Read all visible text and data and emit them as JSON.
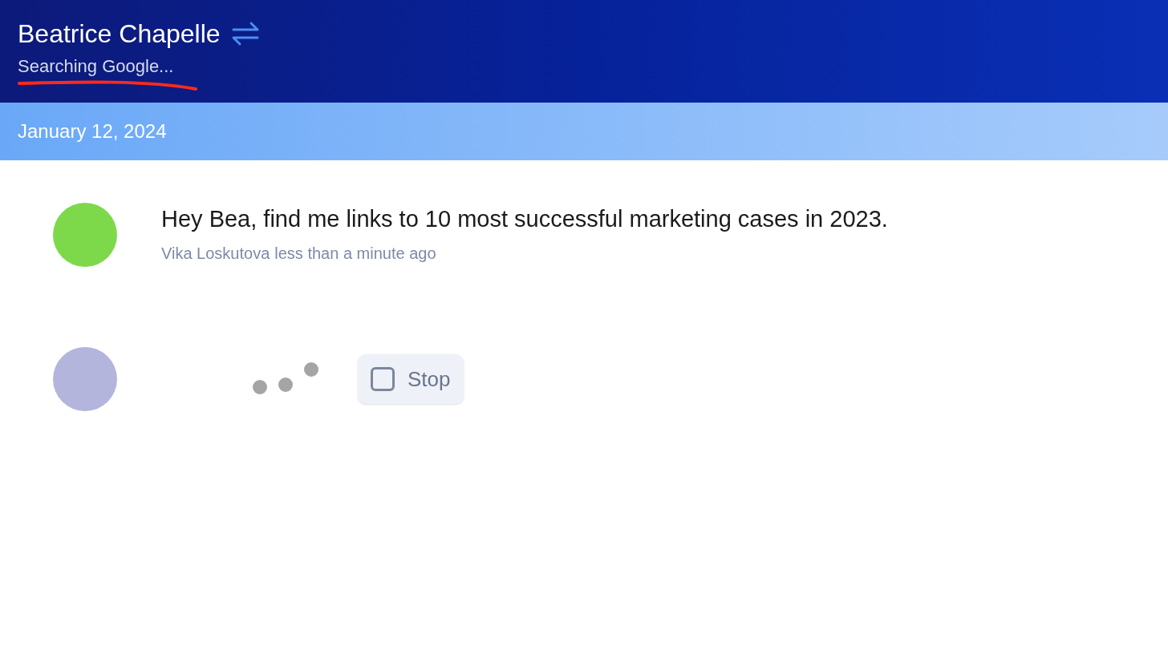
{
  "header": {
    "title": "Beatrice Chapelle",
    "status": "Searching Google..."
  },
  "date_bar": {
    "date": "January 12, 2024"
  },
  "messages": [
    {
      "kind": "text",
      "text": "Hey Bea, find me links to 10 most successful marketing cases in 2023.",
      "author": "Vika Loskutova",
      "time": "less than a minute ago"
    },
    {
      "kind": "typing",
      "stop_label": "Stop"
    }
  ]
}
